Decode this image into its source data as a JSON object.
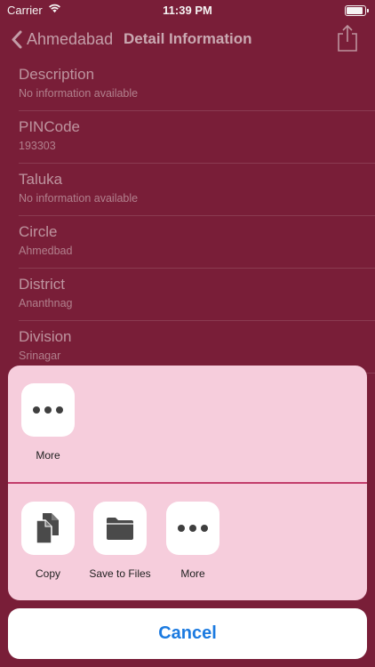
{
  "status_bar": {
    "carrier": "Carrier",
    "time": "11:39 PM"
  },
  "nav": {
    "back_label": "Ahmedabad",
    "title": "Detail Information"
  },
  "rows": [
    {
      "label": "Description",
      "value": "No information available"
    },
    {
      "label": "PINCode",
      "value": "193303"
    },
    {
      "label": "Taluka",
      "value": "No information available"
    },
    {
      "label": "Circle",
      "value": "Ahmedbad"
    },
    {
      "label": "District",
      "value": "Ananthnag"
    },
    {
      "label": "Division",
      "value": "Srinagar"
    }
  ],
  "share_sheet": {
    "top_actions": [
      {
        "label": "More",
        "icon": "more-icon"
      }
    ],
    "bottom_actions": [
      {
        "label": "Copy",
        "icon": "copy-icon"
      },
      {
        "label": "Save to Files",
        "icon": "folder-icon"
      },
      {
        "label": "More",
        "icon": "more-icon"
      }
    ],
    "cancel_label": "Cancel"
  },
  "colors": {
    "background": "#7d1f3a",
    "sheet": "#f6cddc",
    "divider": "#c23c6b",
    "accent": "#1b7ae0"
  }
}
